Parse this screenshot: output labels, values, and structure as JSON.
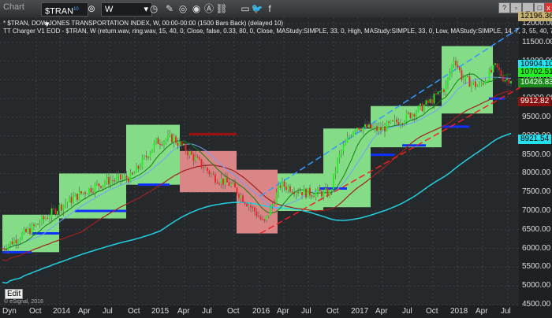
{
  "window": {
    "title": "Chart",
    "symbol": "$TRAN",
    "symbol_badge": "10",
    "interval": "W",
    "buttons": [
      "help",
      "restore-pane",
      "minimize",
      "maximize",
      "close"
    ]
  },
  "info": {
    "line1": "* $TRAN, DOW JONES TRANSPORTATION INDEX, W, 00:00-00:00 (1500 Bars Back) (delayed 10)",
    "line2": "TT Charger V1 EOD - $TRAN, W (return.wav, ring.wav, 15, 40, 0, Close, false, 0.33, 80, 0, Close, MAStudy:SIMPLE, 33, 0, High, MAStudy:SIMPLE, 33, 0, Low, MAStudy:SIMPLE, 14, 7, 3, 55, 40, 7, 3, 7, 75, 25)"
  },
  "y_axis": {
    "labels": [
      "12000.00",
      "11500.00",
      "11000.00",
      "10500.00",
      "10000.00",
      "9500.00",
      "9000.00",
      "8500.00",
      "8000.00",
      "7500.00",
      "7000.00",
      "6500.00",
      "6000.00",
      "5500.00",
      "5000.00",
      "4500.00"
    ]
  },
  "price_tags": [
    {
      "text": "12196.36",
      "value": 12196.36,
      "color": "#c8b070"
    },
    {
      "text": "10904.10",
      "value": 10904.1,
      "color": "#22e0f0"
    },
    {
      "text": "10702.51",
      "value": 10702.51,
      "color": "#22ee22"
    },
    {
      "text": "10426.83",
      "value": 10426.83,
      "color": "#1a8a1a"
    },
    {
      "text": "9912.82",
      "value": 9912.82,
      "color": "#8a1010"
    },
    {
      "text": "8921.54",
      "value": 8921.54,
      "color": "#22e0f0"
    }
  ],
  "x_axis": {
    "labels": [
      "Oct",
      "2014",
      "Apr",
      "Jul",
      "Oct",
      "2015",
      "Apr",
      "Jul",
      "Oct",
      "2016",
      "Apr",
      "Jul",
      "Oct",
      "2017",
      "Apr",
      "Jul",
      "Oct",
      "2018",
      "Apr",
      "Jul"
    ]
  },
  "footer": {
    "dyn": "Dyn",
    "edit": "Edit",
    "copyright": "© eSignal, 2018"
  },
  "chart_data": {
    "type": "candlestick",
    "ylim": [
      4500,
      12000
    ],
    "monthly_close_approx": [
      [
        "2013-10",
        6540
      ],
      [
        "2014-01",
        7065
      ],
      [
        "2014-04",
        7485
      ],
      [
        "2014-07",
        7800
      ],
      [
        "2014-10",
        7900
      ],
      [
        "2015-01",
        8850
      ],
      [
        "2015-03",
        8950
      ],
      [
        "2015-06",
        8325
      ],
      [
        "2015-08",
        7900
      ],
      [
        "2015-10",
        7700
      ],
      [
        "2016-01",
        6960
      ],
      [
        "2016-02",
        6650
      ],
      [
        "2016-04",
        7700
      ],
      [
        "2016-07",
        7485
      ],
      [
        "2016-10",
        7485
      ],
      [
        "2016-11",
        8430
      ],
      [
        "2017-01",
        9270
      ],
      [
        "2017-04",
        9165
      ],
      [
        "2017-07",
        9480
      ],
      [
        "2017-10",
        9900
      ],
      [
        "2017-12",
        10320
      ],
      [
        "2018-01",
        11100
      ],
      [
        "2018-02",
        10530
      ],
      [
        "2018-04",
        10320
      ],
      [
        "2018-06",
        10845
      ],
      [
        "2018-07",
        10530
      ]
    ],
    "colors": {
      "up": "#22ee22",
      "down": "#ee2222",
      "bull_zone": "#90f090",
      "bear_zone": "#f09090",
      "ma_long": "#22d0e0",
      "support": "#1030ff"
    }
  }
}
